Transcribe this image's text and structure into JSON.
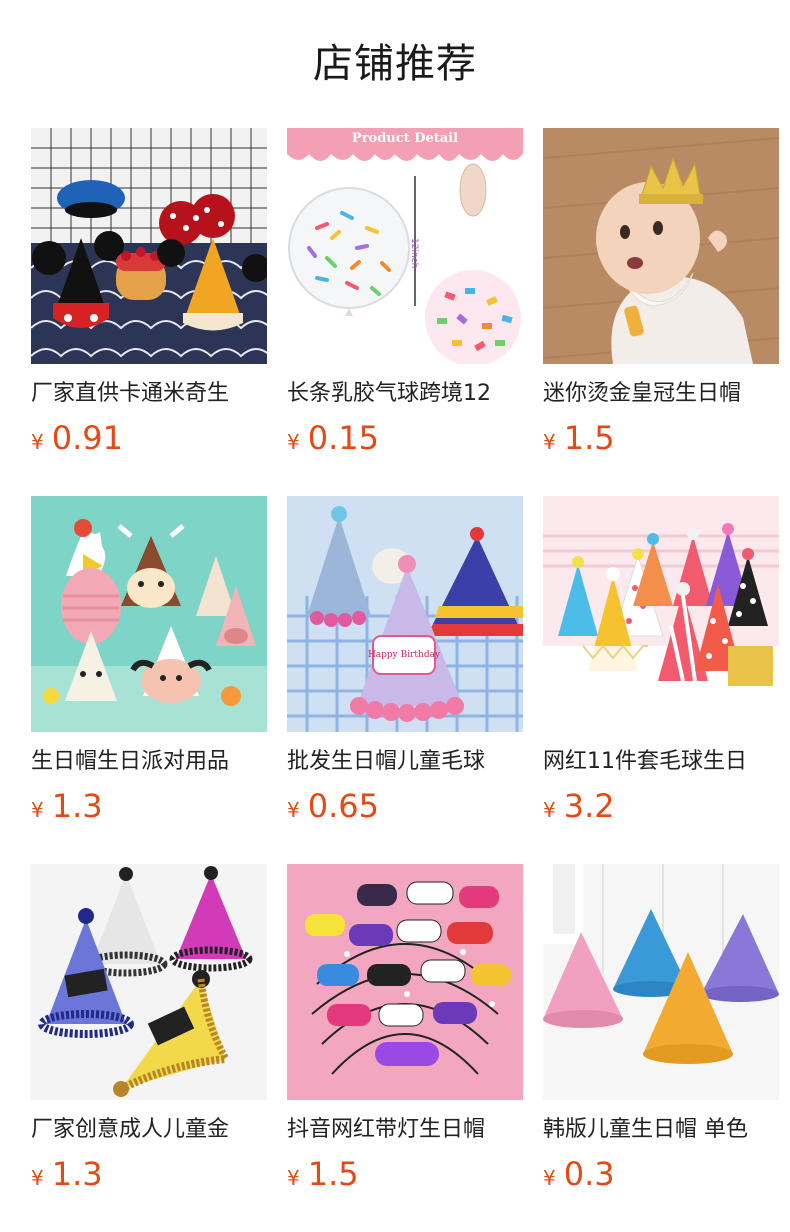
{
  "section": {
    "title": "店铺推荐"
  },
  "products": [
    {
      "name": "厂家直供卡通米奇生",
      "currency": "¥",
      "price": "0.91",
      "icon": "mickey-party-hats-image"
    },
    {
      "name": "长条乳胶气球跨境12",
      "currency": "¥",
      "price": "0.15",
      "icon": "confetti-balloon-image",
      "image_text": "Product Detail",
      "image_label": "12inch"
    },
    {
      "name": "迷你烫金皇冠生日帽",
      "currency": "¥",
      "price": "1.5",
      "icon": "baby-crown-image"
    },
    {
      "name": "生日帽生日派对用品",
      "currency": "¥",
      "price": "1.3",
      "icon": "animal-party-hats-image"
    },
    {
      "name": "批发生日帽儿童毛球",
      "currency": "¥",
      "price": "0.65",
      "icon": "pompom-birthday-hats-image",
      "image_text": "Happy Birthday"
    },
    {
      "name": "网红11件套毛球生日",
      "currency": "¥",
      "price": "3.2",
      "icon": "pattern-party-hats-image"
    },
    {
      "name": "厂家创意成人儿童金",
      "currency": "¥",
      "price": "1.3",
      "icon": "glitter-tinsel-hats-image"
    },
    {
      "name": "抖音网红带灯生日帽",
      "currency": "¥",
      "price": "1.5",
      "icon": "led-headband-image"
    },
    {
      "name": "韩版儿童生日帽 单色",
      "currency": "¥",
      "price": "0.3",
      "icon": "solid-color-hats-image"
    }
  ]
}
